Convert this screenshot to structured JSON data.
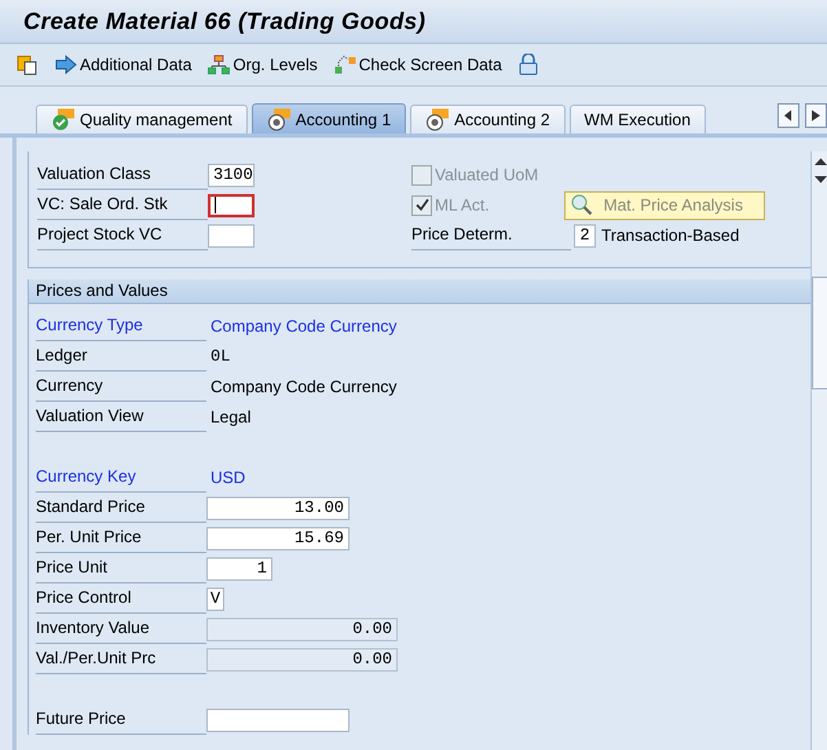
{
  "window": {
    "title": "Create Material 66 (Trading Goods)"
  },
  "toolbar": [
    {
      "kind": "copy"
    },
    {
      "kind": "arrow",
      "label": "Additional Data"
    },
    {
      "kind": "org",
      "label": "Org. Levels"
    },
    {
      "kind": "check",
      "label": "Check Screen Data"
    },
    {
      "kind": "lock"
    }
  ],
  "tabs": [
    {
      "label": "Quality management",
      "kind": "complete",
      "selected": false
    },
    {
      "label": "Accounting 1",
      "kind": "open",
      "selected": true
    },
    {
      "label": "Accounting 2",
      "kind": "open",
      "selected": false
    },
    {
      "label": "WM Execution",
      "kind": "plain",
      "selected": false
    }
  ],
  "general": {
    "fields": [
      {
        "label": "Valuation Class",
        "value": "3100",
        "focused": false
      },
      {
        "label": "VC: Sale Ord. Stk",
        "focused": true
      },
      {
        "label": "Project Stock VC",
        "focused": false
      }
    ],
    "checks": [
      {
        "label": "Valuated UoM",
        "checked": false,
        "disabled": true
      },
      {
        "label": "ML Act.",
        "checked": true,
        "disabled": true
      }
    ],
    "button": {
      "label": "Mat. Price Analysis",
      "disabled": true
    },
    "price_determination": {
      "label": "Price Determ.",
      "value": "2",
      "text": "Transaction-Based"
    }
  },
  "prices": {
    "title": "Prices and Values",
    "rows": [
      {
        "kind": "link",
        "label": "Currency Type",
        "value": "Company Code Currency"
      },
      {
        "kind": "code",
        "label": "Ledger",
        "value": "0L"
      },
      {
        "kind": "text",
        "label": "Currency",
        "value": "Company Code Currency"
      },
      {
        "kind": "text",
        "label": "Valuation View",
        "value": "Legal"
      },
      {
        "kind": "spacer"
      },
      {
        "kind": "link",
        "label": "Currency Key",
        "value": "USD"
      },
      {
        "kind": "amount",
        "label": "Standard Price",
        "value": "13.00"
      },
      {
        "kind": "amount",
        "label": "Per. Unit Price",
        "value": "15.69"
      },
      {
        "kind": "count",
        "label": "Price Unit",
        "value": "1"
      },
      {
        "kind": "flag",
        "label": "Price Control",
        "value": "V"
      },
      {
        "kind": "readonly",
        "label": "Inventory Value",
        "value": "0.00"
      },
      {
        "kind": "readonly",
        "label": "Val./Per.Unit Prc",
        "value": "0.00"
      },
      {
        "kind": "spacer"
      },
      {
        "kind": "amount",
        "label": "Future Price"
      }
    ]
  }
}
